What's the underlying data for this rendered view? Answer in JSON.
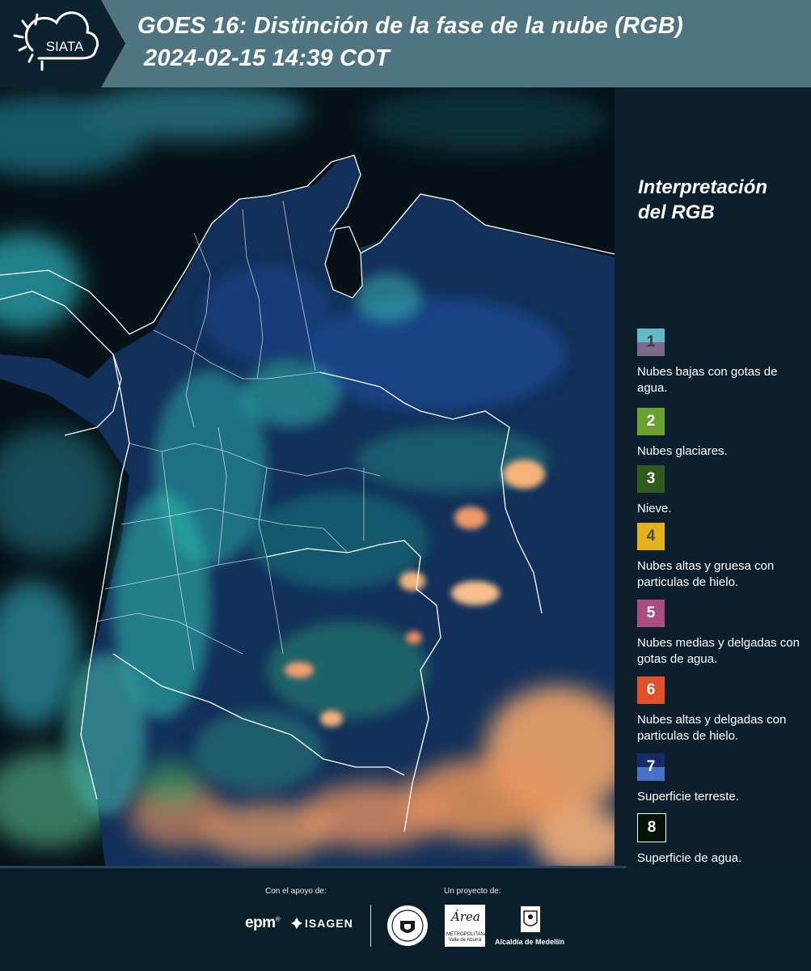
{
  "header": {
    "title_line1": "GOES 16: Distinción de la fase de la nube (RGB)",
    "title_line2": "2024-02-15 14:39 COT",
    "logo_text": "SIATA"
  },
  "legend": {
    "title_line1": "Interpretación",
    "title_line2": "del RGB",
    "items": [
      {
        "number": "1",
        "label": "Nubes bajas con gotas de agua.",
        "color_top": "#64b9c6",
        "color_bottom": "#7c6a8a",
        "text_color": "#3a3a3a"
      },
      {
        "number": "2",
        "label": "Nubes glaciares.",
        "color_top": "#6aa22f",
        "color_bottom": "#6aa22f",
        "text_color": "#ffffff"
      },
      {
        "number": "3",
        "label": "Nieve.",
        "color_top": "#2f5b1d",
        "color_bottom": "#2f5b1d",
        "text_color": "#ffffff"
      },
      {
        "number": "4",
        "label": "Nubes altas y gruesa con particulas de hielo.",
        "color_top": "#e2b21c",
        "color_bottom": "#e2b21c",
        "text_color": "#4a4a4a"
      },
      {
        "number": "5",
        "label": "Nubes medias y delgadas con gotas de agua.",
        "color_top": "#a84e82",
        "color_bottom": "#a84e82",
        "text_color": "#ffffff"
      },
      {
        "number": "6",
        "label": "Nubes altas y delgadas con particulas de hielo.",
        "color_top": "#e1502a",
        "color_bottom": "#e1502a",
        "text_color": "#ffffff"
      },
      {
        "number": "7",
        "label": "Superficie terreste.",
        "color_top": "#172a6a",
        "color_bottom": "#4a72c4",
        "text_color": "#ffffff"
      },
      {
        "number": "8",
        "label": "Superficie de agua.",
        "color_top": "#061308",
        "color_bottom": "#061308",
        "text_color": "#ffffff"
      }
    ]
  },
  "footer": {
    "support_label": "Con el apoyo de:",
    "project_label": "Un proyecto de:",
    "epm_logo": "epm",
    "isagen_logo": "ISAGEN",
    "area_logo_script": "Área",
    "area_logo_small": "METROPOLITANA Valle de Aburrá",
    "alcaldia_logo": "Alcaldía de Medellín"
  },
  "colors": {
    "header_bg": "#4f7482",
    "page_bg": "#0b1e2b",
    "legend_bg": "#0d1f2d",
    "ocean": "#061218"
  }
}
